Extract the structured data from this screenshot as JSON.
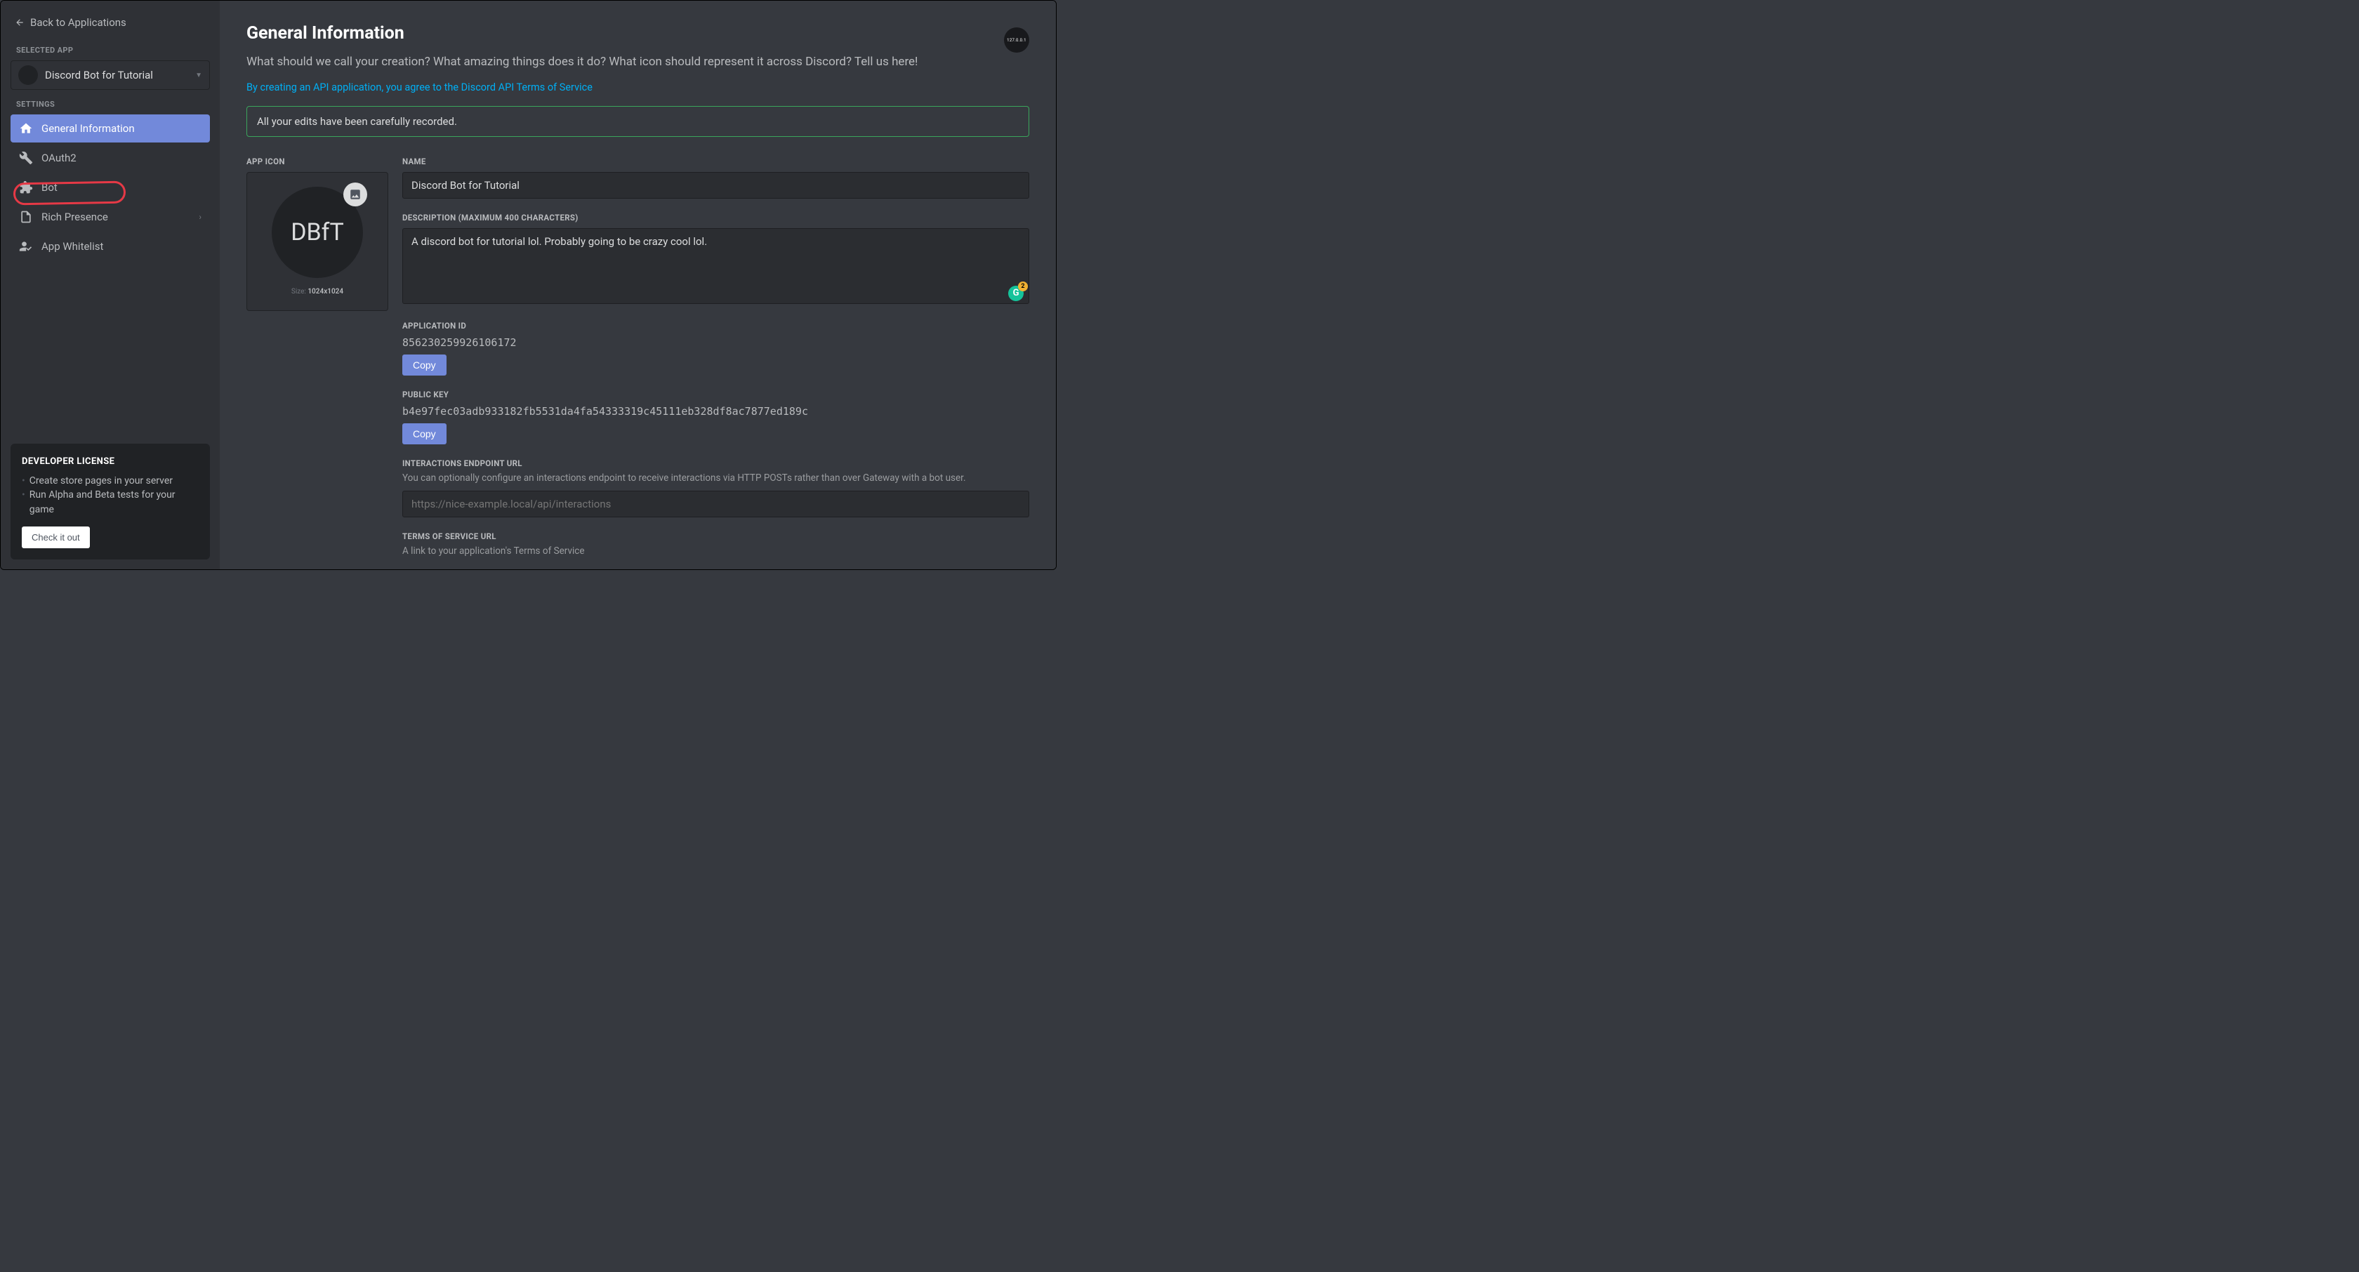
{
  "sidebar": {
    "back_label": "Back to Applications",
    "selected_app_label": "SELECTED APP",
    "selected_app_name": "Discord Bot for Tutorial",
    "settings_label": "SETTINGS",
    "items": [
      {
        "label": "General Information"
      },
      {
        "label": "OAuth2"
      },
      {
        "label": "Bot"
      },
      {
        "label": "Rich Presence"
      },
      {
        "label": "App Whitelist"
      }
    ]
  },
  "dev_license": {
    "title": "DEVELOPER LICENSE",
    "bullets": [
      "Create store pages in your server",
      "Run Alpha and Beta tests for your game"
    ],
    "button": "Check it out"
  },
  "main": {
    "title": "General Information",
    "subtitle": "What should we call your creation? What amazing things does it do? What icon should represent it across Discord? Tell us here!",
    "tos_text": "By creating an API application, you agree to the Discord API Terms of Service",
    "alert": "All your edits have been carefully recorded.",
    "corner_label": "127.0.0.1",
    "app_icon": {
      "label": "APP ICON",
      "initials": "DBfT",
      "size_prefix": "Size: ",
      "size_value": "1024x1024"
    },
    "name": {
      "label": "NAME",
      "value": "Discord Bot for Tutorial"
    },
    "description": {
      "label": "DESCRIPTION (MAXIMUM 400 CHARACTERS)",
      "value": "A discord bot for tutorial lol. Probably going to be crazy cool lol."
    },
    "grammarly_badge": "2",
    "application_id": {
      "label": "APPLICATION ID",
      "value": "856230259926106172",
      "copy": "Copy"
    },
    "public_key": {
      "label": "PUBLIC KEY",
      "value": "b4e97fec03adb933182fb5531da4fa54333319c45111eb328df8ac7877ed189c",
      "copy": "Copy"
    },
    "interactions": {
      "label": "INTERACTIONS ENDPOINT URL",
      "help": "You can optionally configure an interactions endpoint to receive interactions via HTTP POSTs rather than over Gateway with a bot user.",
      "placeholder": "https://nice-example.local/api/interactions"
    },
    "tos_url": {
      "label": "TERMS OF SERVICE URL",
      "help": "A link to your application's Terms of Service"
    }
  }
}
